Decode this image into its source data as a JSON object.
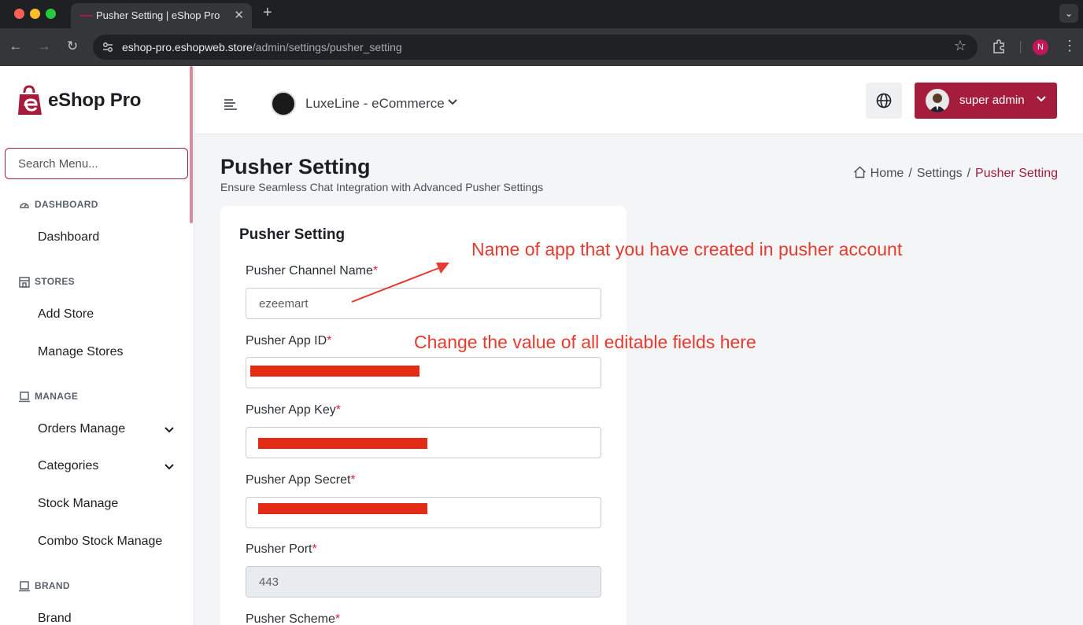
{
  "browser": {
    "tab_title": "Pusher Setting | eShop Pro",
    "url_domain": "eshop-pro.eshopweb.store",
    "url_path": "/admin/settings/pusher_setting",
    "profile_initial": "N"
  },
  "sidebar": {
    "brand": "eShop Pro",
    "search_placeholder": "Search Menu...",
    "sections": [
      {
        "heading": "DASHBOARD",
        "items": [
          "Dashboard"
        ]
      },
      {
        "heading": "STORES",
        "items": [
          "Add Store",
          "Manage Stores"
        ]
      },
      {
        "heading": "MANAGE",
        "items": [
          "Orders Manage",
          "Categories",
          "Stock Manage",
          "Combo Stock Manage"
        ]
      },
      {
        "heading": "BRAND",
        "items": [
          "Brand"
        ]
      }
    ]
  },
  "header": {
    "store_name": "LuxeLine - eCommerce",
    "user_name": "super admin"
  },
  "page": {
    "title": "Pusher Setting",
    "subtitle": "Ensure Seamless Chat Integration with Advanced Pusher Settings",
    "breadcrumb": [
      "Home",
      "Settings",
      "Pusher Setting"
    ]
  },
  "form": {
    "card_title": "Pusher Setting",
    "fields": [
      {
        "label": "Pusher Channel Name",
        "value": "ezeemart"
      },
      {
        "label": "Pusher App ID",
        "value": ""
      },
      {
        "label": "Pusher App Key",
        "value": ""
      },
      {
        "label": "Pusher App Secret",
        "value": ""
      },
      {
        "label": "Pusher Port",
        "value": "443"
      },
      {
        "label": "Pusher Scheme",
        "value": ""
      }
    ],
    "required_mark": "*"
  },
  "annotations": {
    "channel_note": "Name of app that you have created in pusher account",
    "fields_note": "Change the value of all editable fields here",
    "color": "#e63b2e"
  },
  "colors": {
    "accent": "#a51c3d",
    "redaction": "#e32b16"
  }
}
